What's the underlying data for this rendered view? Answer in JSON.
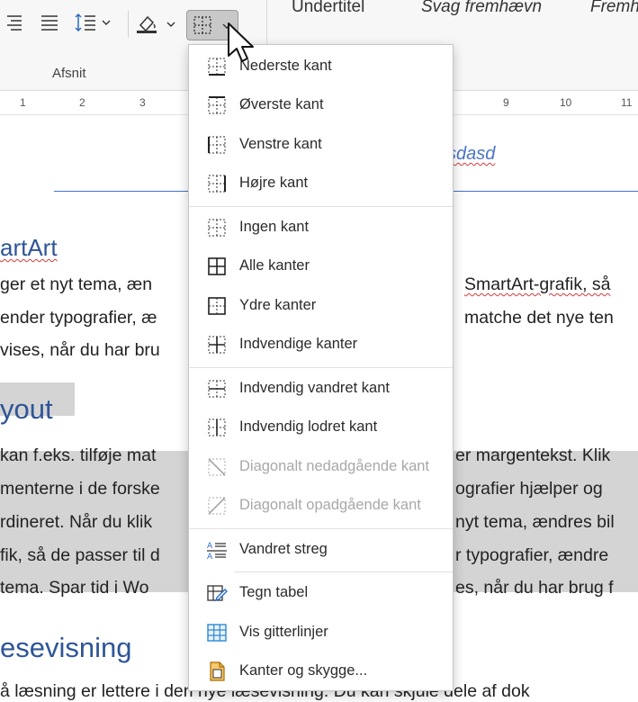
{
  "ribbon": {
    "group_label": "Afsnit",
    "styles": [
      "Undertitel",
      "Svag fremhævn",
      "Fremh"
    ],
    "ruler_numbers": [
      "1",
      "2",
      "3",
      "9",
      "10",
      "11"
    ]
  },
  "document": {
    "header_text": "sdasd",
    "heading_smartart": "artArt",
    "smartart_lines": [
      "ger et nyt tema, æn",
      "ender typografier, æ",
      "vises, når du har bru"
    ],
    "smartart_right_lines": [
      "SmartArt-grafik, så",
      "matche det nye ten",
      ""
    ],
    "heading_layout": "yout",
    "layout_lines": [
      "kan f.eks. tilføje mat",
      "menterne i de forske",
      "rdineret. Når du klik",
      "fik, så de passer til d",
      " tema. Spar tid i Wo"
    ],
    "layout_right_lines": [
      "er margentekst. Klik",
      "ografier hjælper og",
      "nyt tema, ændres bil",
      "r typografier, ændre",
      "es, når du har brug f"
    ],
    "heading_lese": "esevisning",
    "last_line": "å læsning er lettere i den nye læsevisning. Du kan skjule dele af dok"
  },
  "menu": {
    "items": [
      {
        "label": "Nederste kant",
        "icon": "bottom-border-icon",
        "disabled": false
      },
      {
        "label": "Øverste kant",
        "icon": "top-border-icon",
        "disabled": false
      },
      {
        "label": "Venstre kant",
        "icon": "left-border-icon",
        "disabled": false
      },
      {
        "label": "Højre kant",
        "icon": "right-border-icon",
        "disabled": false
      },
      {
        "label": "Ingen kant",
        "icon": "no-border-icon",
        "disabled": false
      },
      {
        "label": "Alle kanter",
        "icon": "all-borders-icon",
        "disabled": false
      },
      {
        "label": "Ydre kanter",
        "icon": "outside-borders-icon",
        "disabled": false
      },
      {
        "label": "Indvendige kanter",
        "icon": "inside-borders-icon",
        "disabled": false
      },
      {
        "label": "Indvendig vandret kant",
        "icon": "inside-horizontal-border-icon",
        "disabled": false
      },
      {
        "label": "Indvendig lodret kant",
        "icon": "inside-vertical-border-icon",
        "disabled": false
      },
      {
        "label": "Diagonalt nedadgående kant",
        "icon": "diagonal-down-border-icon",
        "disabled": true
      },
      {
        "label": "Diagonalt opadgående kant",
        "icon": "diagonal-up-border-icon",
        "disabled": true
      },
      {
        "label": "Vandret streg",
        "icon": "horizontal-line-icon",
        "disabled": false
      },
      {
        "label": "Tegn tabel",
        "icon": "draw-table-icon",
        "disabled": false
      },
      {
        "label": "Vis gitterlinjer",
        "icon": "view-gridlines-icon",
        "disabled": false
      },
      {
        "label": "Kanter og skygge...",
        "icon": "borders-shading-icon",
        "disabled": false
      }
    ]
  },
  "colors": {
    "accent": "#4472c4",
    "heading": "#2e5597",
    "selection": "#d4d4d4",
    "grid_icon": "#2b88d8"
  }
}
